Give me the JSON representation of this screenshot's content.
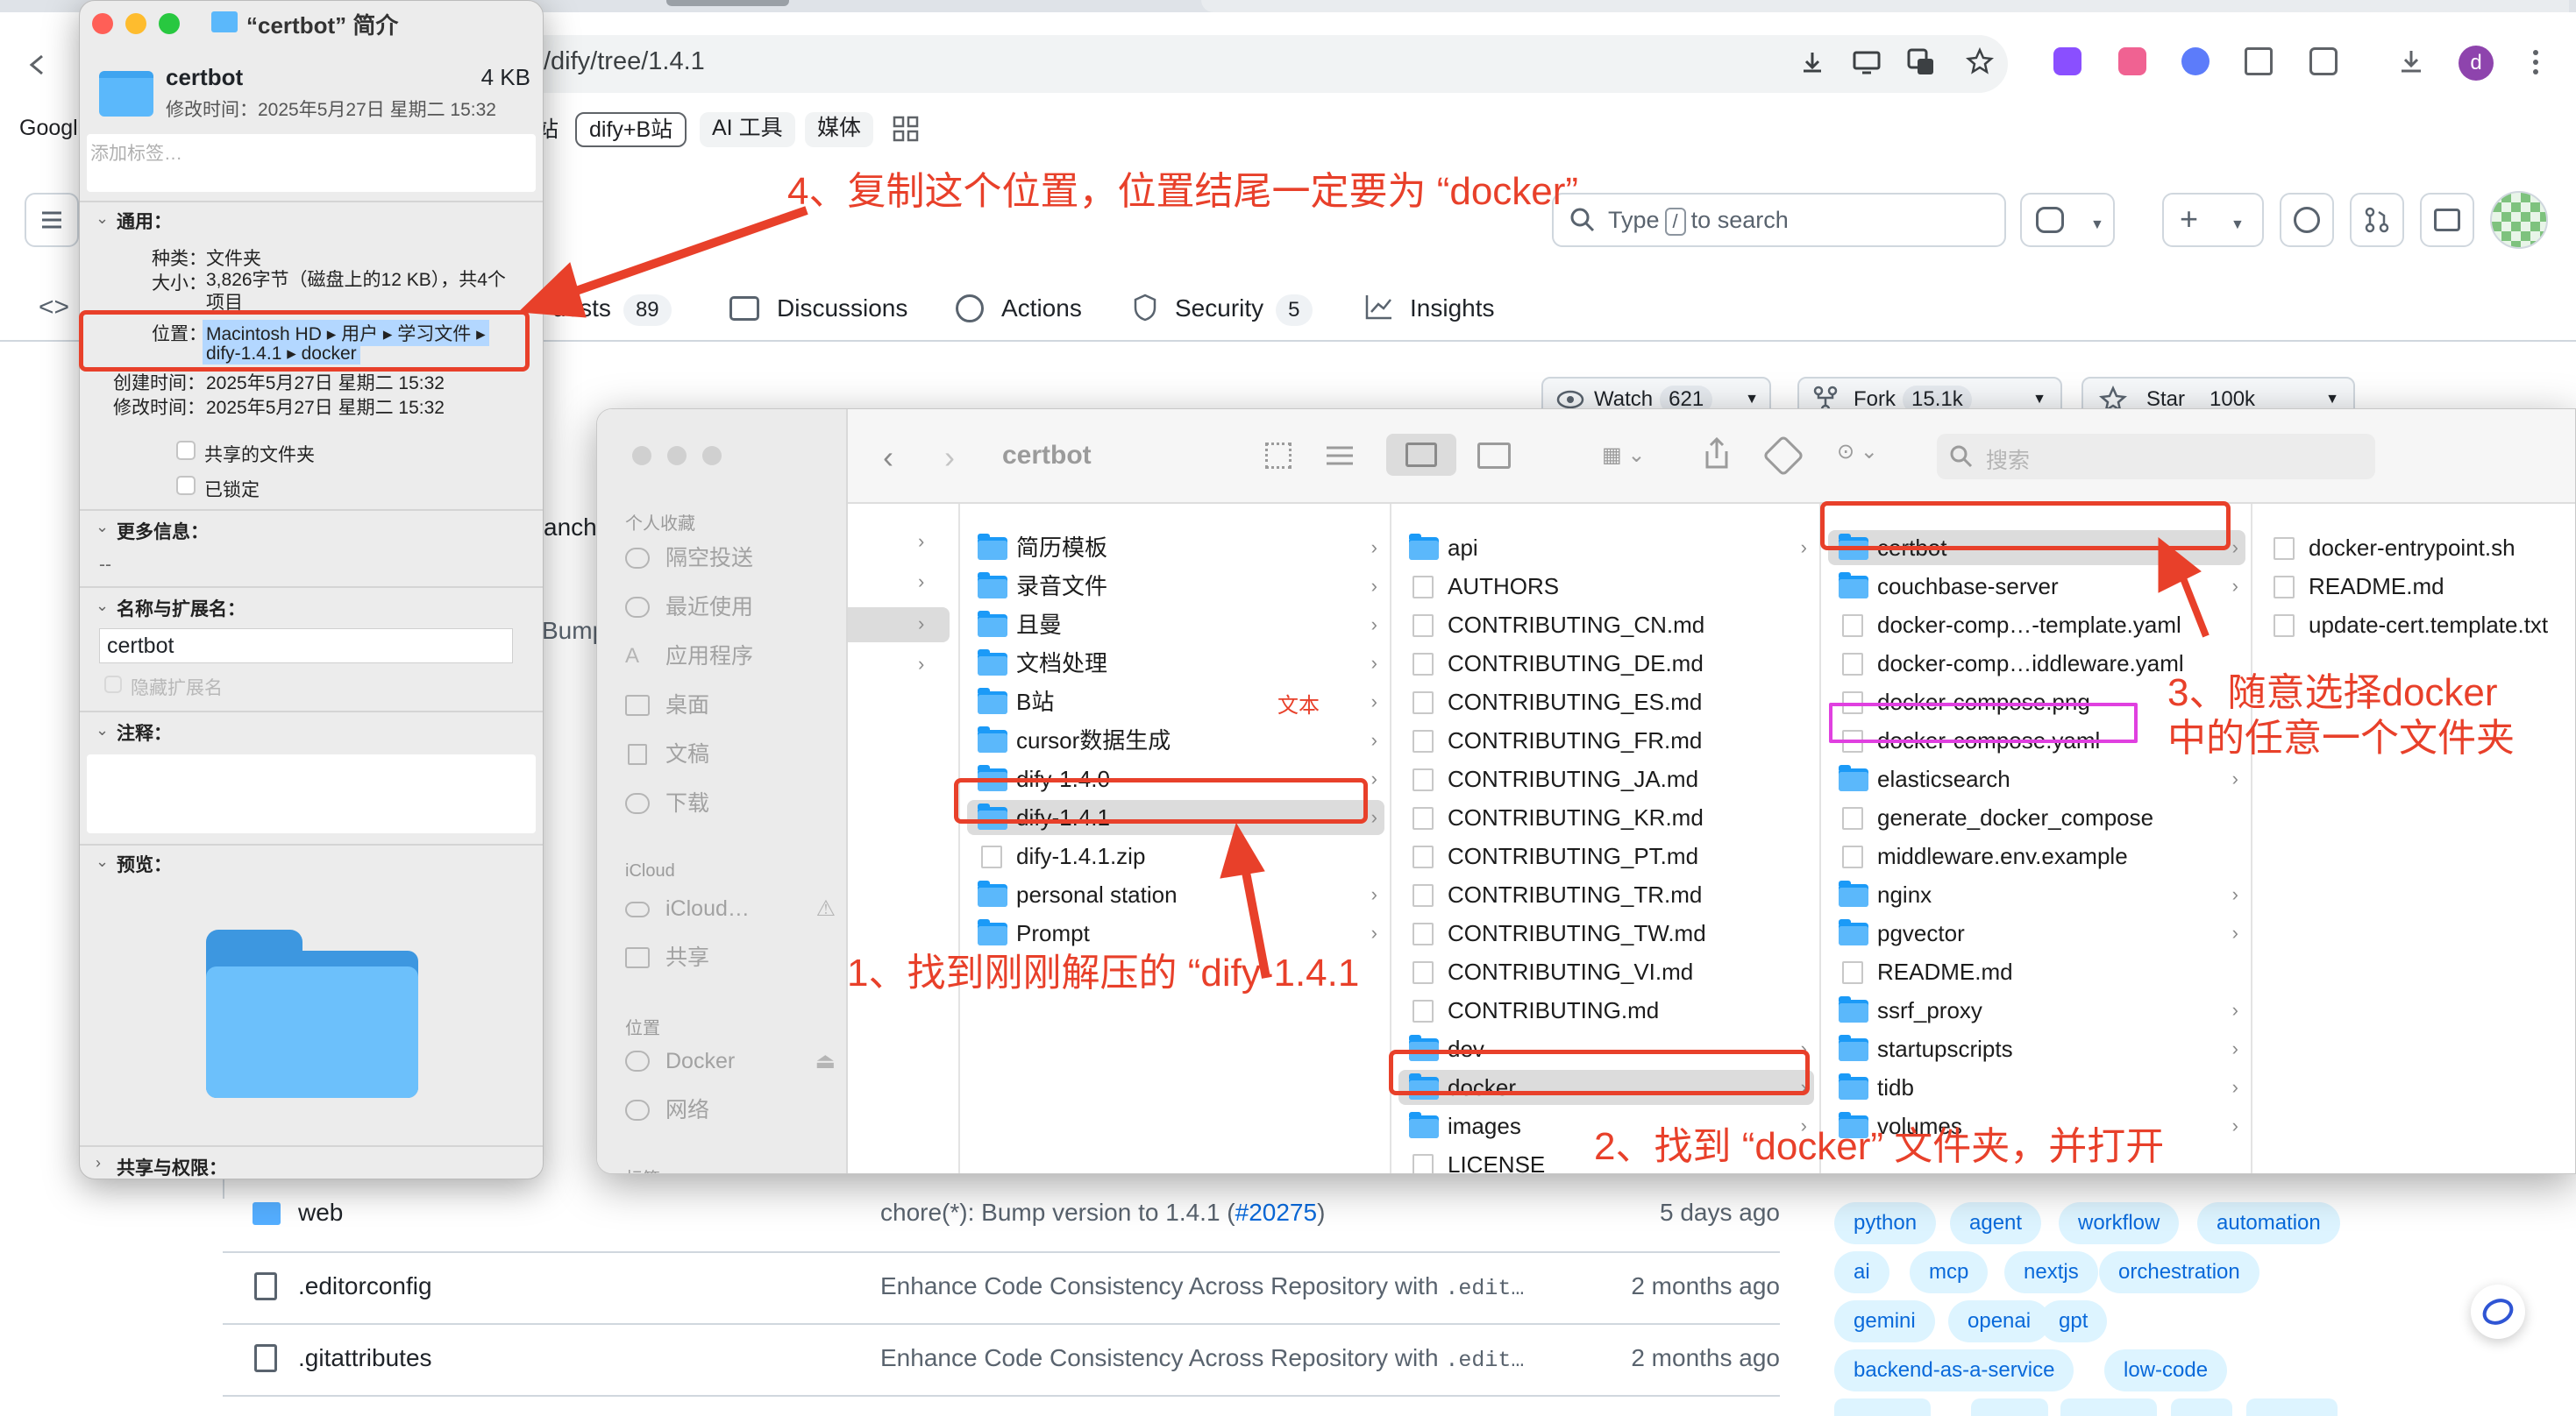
{
  "browser": {
    "url": "/dify/tree/1.4.1",
    "bookmarks": [
      "Googl",
      "dify+B站",
      "AI 工具",
      "媒体"
    ],
    "bookmark_suffix": "站",
    "avatar_letter": "d"
  },
  "github": {
    "search_prefix": "Type",
    "search_key": "/",
    "search_suffix": "to search",
    "nav": [
      {
        "label": "uests",
        "count": "89"
      },
      {
        "label": "Discussions",
        "count": ""
      },
      {
        "label": "Actions",
        "count": ""
      },
      {
        "label": "Security",
        "count": "5"
      },
      {
        "label": "Insights",
        "count": ""
      }
    ],
    "watch": {
      "label": "Watch",
      "count": "621"
    },
    "fork": {
      "label": "Fork",
      "count": "15.1k"
    },
    "star": {
      "label": "Star",
      "count": "100k"
    },
    "left_fragments": [
      "anch",
      "Bump"
    ],
    "files": [
      {
        "name": "web",
        "type": "folder",
        "message": "chore(*): Bump version to 1.4.1 (",
        "link": "#20275",
        "message_end": ")",
        "age": "5 days ago"
      },
      {
        "name": ".editorconfig",
        "type": "file",
        "message": "Enhance Code Consistency Across Repository with ",
        "code": ".edit…",
        "age": "2 months ago"
      },
      {
        "name": ".gitattributes",
        "type": "file",
        "message": "Enhance Code Consistency Across Repository with ",
        "code": ".edit…",
        "age": "2 months ago"
      }
    ],
    "topics": [
      "python",
      "agent",
      "workflow",
      "automation",
      "ai",
      "mcp",
      "nextjs",
      "orchestration",
      "gemini",
      "openai",
      "gpt",
      "backend-as-a-service",
      "low-code"
    ]
  },
  "info_panel": {
    "title": "“certbot” 简介",
    "name": "certbot",
    "size": "4 KB",
    "modified_line": "修改时间：2025年5月27日 星期二 15:32",
    "tags_placeholder": "添加标签…",
    "general_header": "通用：",
    "kind_label": "种类：",
    "kind_value": "文件夹",
    "size_label": "大小：",
    "size_value": "3,826字节（磁盘上的12 KB），共4个项目",
    "where_label": "位置：",
    "where_line1": "Macintosh HD ▸ 用户 ▸ 学习文件 ▸",
    "where_line2": "dify-1.4.1 ▸ docker",
    "created_label": "创建时间：",
    "created_value": "2025年5月27日 星期二 15:32",
    "modified_label": "修改时间：",
    "modified_value": "2025年5月27日 星期二 15:32",
    "shared_folder": "共享的文件夹",
    "locked": "已锁定",
    "more_info_header": "更多信息：",
    "more_info_value": "--",
    "name_ext_header": "名称与扩展名：",
    "name_value": "certbot",
    "hide_ext": "隐藏扩展名",
    "comments_header": "注释：",
    "preview_header": "预览：",
    "sharing_header": "共享与权限："
  },
  "finder": {
    "title": "certbot",
    "search_placeholder": "搜索",
    "sidebar": {
      "favorites_header": "个人收藏",
      "favorites": [
        {
          "label": "隔空投送",
          "icon": "airdrop-icon"
        },
        {
          "label": "最近使用",
          "icon": "clock-icon"
        },
        {
          "label": "应用程序",
          "icon": "apps-icon"
        },
        {
          "label": "桌面",
          "icon": "desktop-icon"
        },
        {
          "label": "文稿",
          "icon": "document-icon"
        },
        {
          "label": "下载",
          "icon": "download-icon"
        }
      ],
      "icloud_header": "iCloud",
      "icloud": [
        {
          "label": "iCloud…",
          "icon": "cloud-icon"
        },
        {
          "label": "共享",
          "icon": "shared-folder-icon"
        }
      ],
      "locations_header": "位置",
      "locations": [
        {
          "label": "Docker",
          "icon": "disk-icon"
        },
        {
          "label": "网络",
          "icon": "network-icon"
        }
      ],
      "tags_header": "标签"
    },
    "col2": [
      "简历模板",
      "录音文件",
      "且曼",
      "文档处理",
      "B站",
      "cursor数据生成",
      "dify-1.4.0",
      "dify-1.4.1",
      "dify-1.4.1.zip",
      "personal station",
      "Prompt"
    ],
    "col2_tag": "文本",
    "col3": [
      "api",
      "AUTHORS",
      "CONTRIBUTING_CN.md",
      "CONTRIBUTING_DE.md",
      "CONTRIBUTING_ES.md",
      "CONTRIBUTING_FR.md",
      "CONTRIBUTING_JA.md",
      "CONTRIBUTING_KR.md",
      "CONTRIBUTING_PT.md",
      "CONTRIBUTING_TR.md",
      "CONTRIBUTING_TW.md",
      "CONTRIBUTING_VI.md",
      "CONTRIBUTING.md",
      "dev",
      "docker",
      "images",
      "LICENSE"
    ],
    "col4": [
      "certbot",
      "couchbase-server",
      "docker-comp…-template.yaml",
      "docker-comp…iddleware.yaml",
      "docker-compose.png",
      "docker-compose.yaml",
      "elasticsearch",
      "generate_docker_compose",
      "middleware.env.example",
      "nginx",
      "pgvector",
      "README.md",
      "ssrf_proxy",
      "startupscripts",
      "tidb",
      "volumes"
    ],
    "col5": [
      "docker-entrypoint.sh",
      "README.md",
      "update-cert.template.txt"
    ]
  },
  "annotations": {
    "step1": "1、找到刚刚解压的 “dify-1.4.1",
    "step2": "2、找到 “docker” 文件夹，并打开",
    "step3_line1": "3、随意选择docker",
    "step3_line2": "中的任意一个文件夹",
    "step4": "4、复制这个位置，位置结尾一定要为 “docker”"
  },
  "colors": {
    "annotation_red": "#e8402a",
    "highlight_pink": "#e040e0",
    "finder_folder_blue": "#1b9af7",
    "github_link": "#0969da"
  }
}
